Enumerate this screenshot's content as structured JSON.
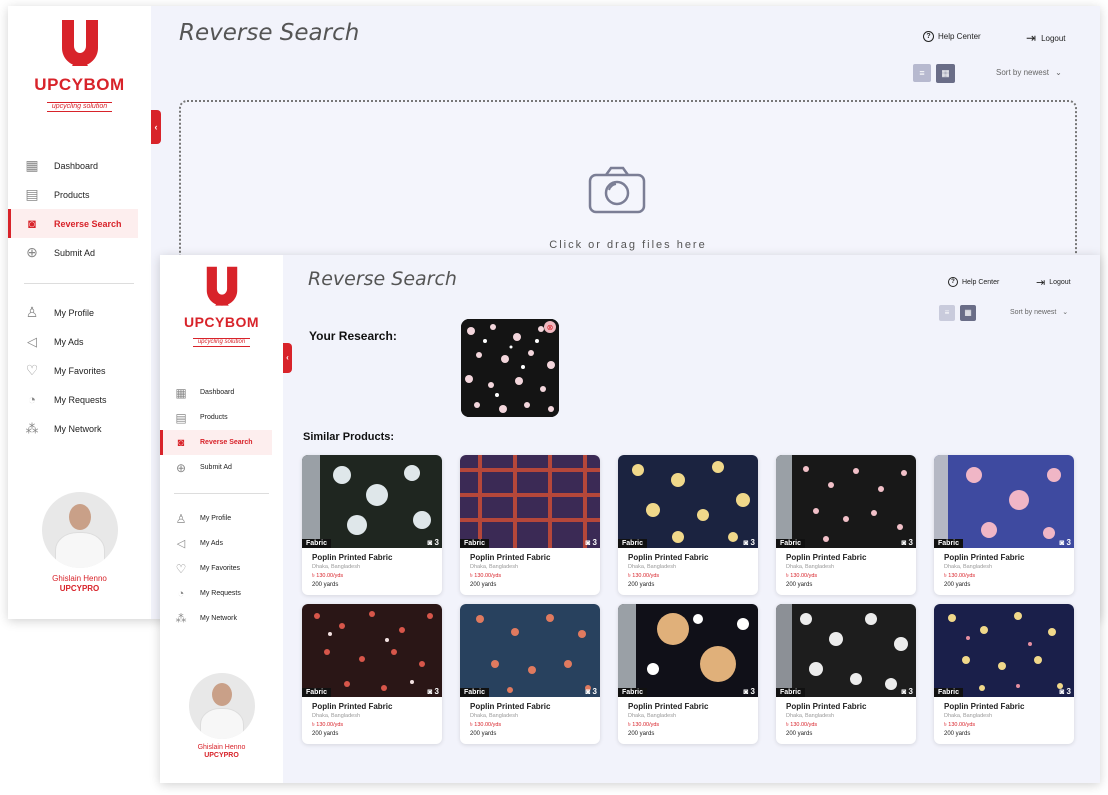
{
  "app": {
    "logo_text": "UPCYBOM",
    "logo_sub": "upcycling solution",
    "accent": "#d8232a"
  },
  "sidebar": {
    "items": [
      {
        "label": "Dashboard",
        "icon": "dashboard-icon"
      },
      {
        "label": "Products",
        "icon": "products-icon"
      },
      {
        "label": "Reverse Search",
        "icon": "camera-icon",
        "active": true
      },
      {
        "label": "Submit Ad",
        "icon": "plus-circle-icon"
      }
    ],
    "items2": [
      {
        "label": "My Profile",
        "icon": "user-icon"
      },
      {
        "label": "My Ads",
        "icon": "megaphone-icon"
      },
      {
        "label": "My Favorites",
        "icon": "heart-icon"
      },
      {
        "label": "My Requests",
        "icon": "bell-icon"
      },
      {
        "label": "My Network",
        "icon": "network-icon"
      }
    ],
    "profile": {
      "name": "Ghislain Henno",
      "role": "UPCYPRO"
    }
  },
  "header": {
    "title": "Reverse Search",
    "help": "Help Center",
    "logout": "Logout",
    "sort": "Sort by newest"
  },
  "upload": {
    "text": "Click or drag files here"
  },
  "results": {
    "research_label": "Your Research:",
    "similar_label": "Similar Products:",
    "products": [
      {
        "tag": "Fabric",
        "count": "3",
        "title": "Poplin Printed Fabric",
        "location": "Dhaka, Bangladesh",
        "price": "৳ 130.00/yds",
        "qty": "200 yards"
      },
      {
        "tag": "Fabric",
        "count": "3",
        "title": "Poplin Printed Fabric",
        "location": "Dhaka, Bangladesh",
        "price": "৳ 130.00/yds",
        "qty": "200 yards"
      },
      {
        "tag": "Fabric",
        "count": "3",
        "title": "Poplin Printed Fabric",
        "location": "Dhaka, Bangladesh",
        "price": "৳ 130.00/yds",
        "qty": "200 yards"
      },
      {
        "tag": "Fabric",
        "count": "3",
        "title": "Poplin Printed Fabric",
        "location": "Dhaka, Bangladesh",
        "price": "৳ 130.00/yds",
        "qty": "200 yards"
      },
      {
        "tag": "Fabric",
        "count": "3",
        "title": "Poplin Printed Fabric",
        "location": "Dhaka, Bangladesh",
        "price": "৳ 130.00/yds",
        "qty": "200 yards"
      },
      {
        "tag": "Fabric",
        "count": "3",
        "title": "Poplin Printed Fabric",
        "location": "Dhaka, Bangladesh",
        "price": "৳ 130.00/yds",
        "qty": "200 yards"
      },
      {
        "tag": "Fabric",
        "count": "3",
        "title": "Poplin Printed Fabric",
        "location": "Dhaka, Bangladesh",
        "price": "৳ 130.00/yds",
        "qty": "200 yards"
      },
      {
        "tag": "Fabric",
        "count": "3",
        "title": "Poplin Printed Fabric",
        "location": "Dhaka, Bangladesh",
        "price": "৳ 130.00/yds",
        "qty": "200 yards"
      },
      {
        "tag": "Fabric",
        "count": "3",
        "title": "Poplin Printed Fabric",
        "location": "Dhaka, Bangladesh",
        "price": "৳ 130.00/yds",
        "qty": "200 yards"
      },
      {
        "tag": "Fabric",
        "count": "3",
        "title": "Poplin Printed Fabric",
        "location": "Dhaka, Bangladesh",
        "price": "৳ 130.00/yds",
        "qty": "200 yards"
      }
    ]
  }
}
